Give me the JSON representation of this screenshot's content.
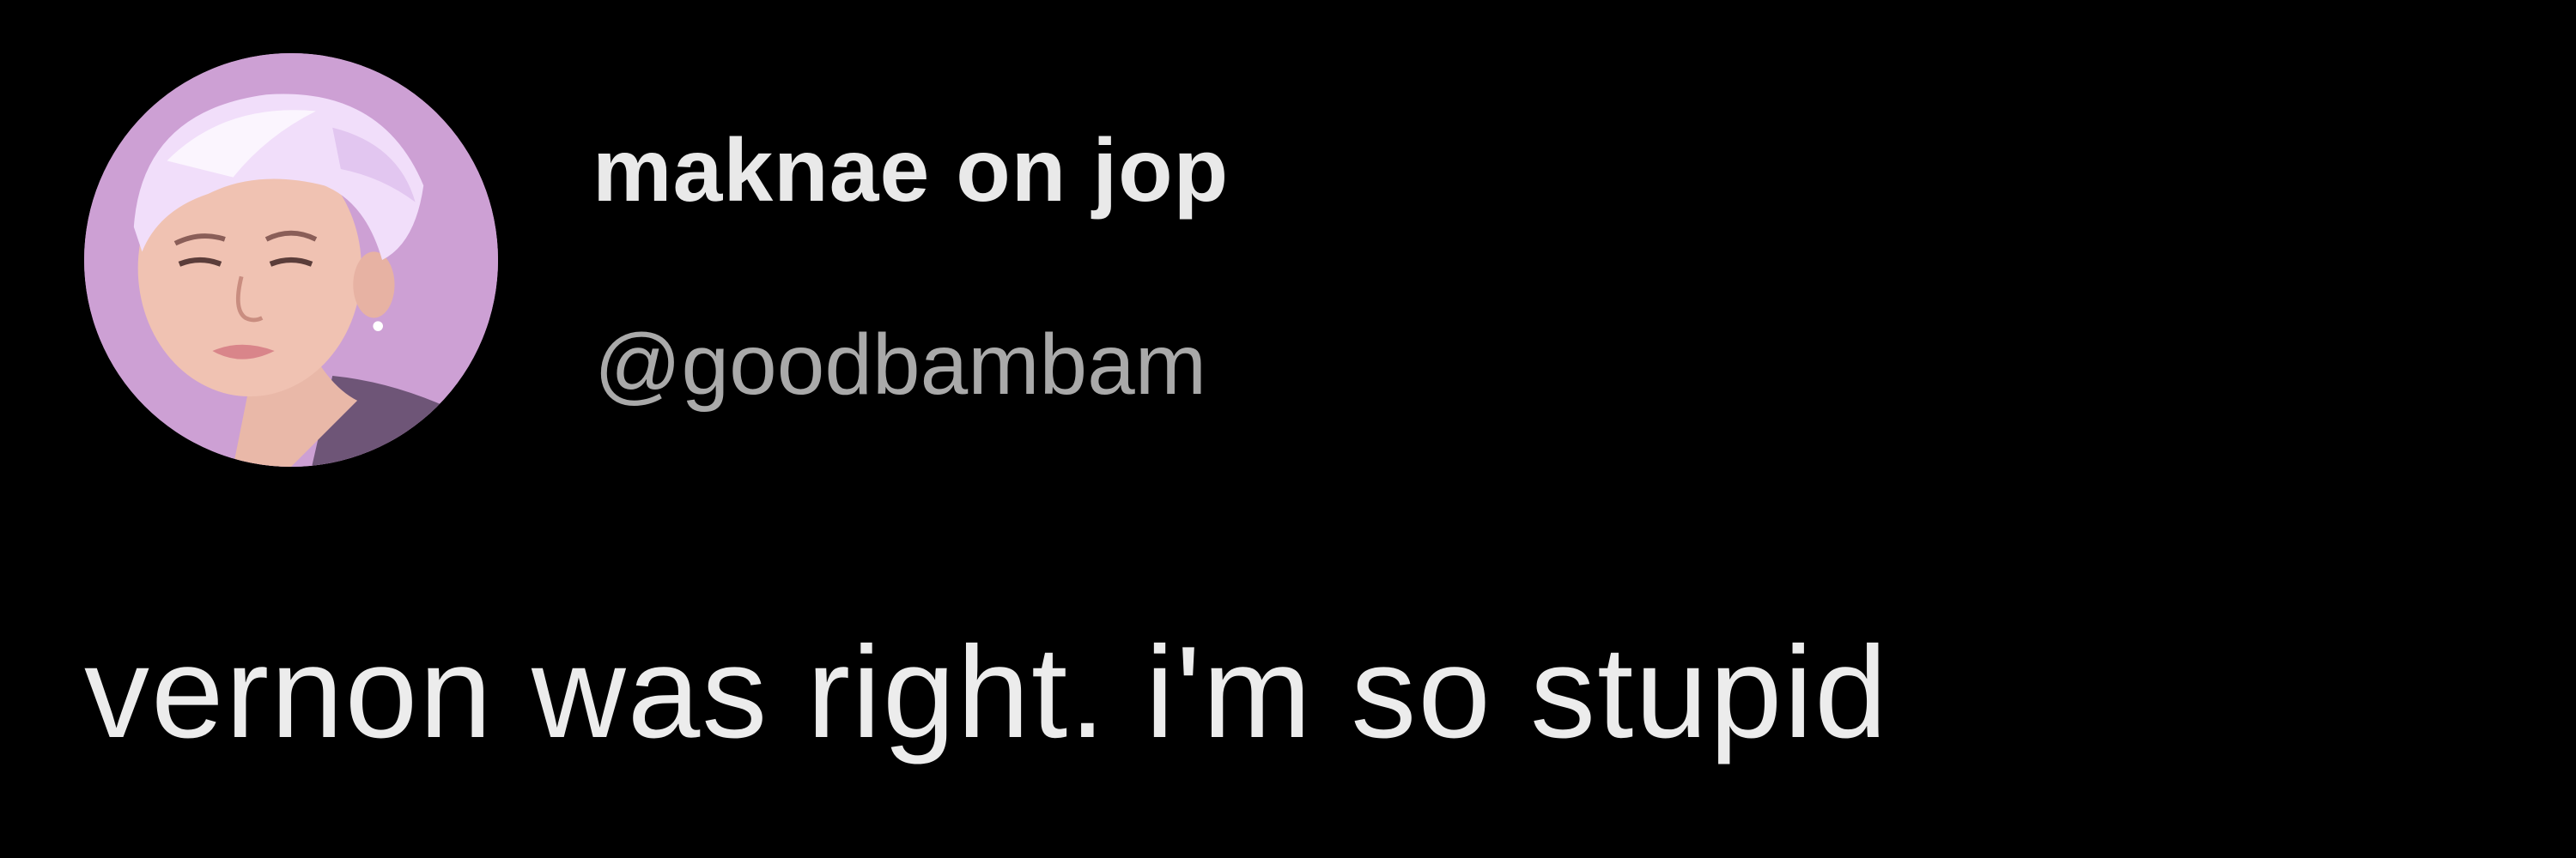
{
  "tweet": {
    "author": {
      "display_name": "maknae on jop",
      "handle": "@goodbambam",
      "avatar_icon": "profile-photo-avatar"
    },
    "text": "vernon was right. i'm so stupid"
  },
  "colors": {
    "background": "#000000",
    "name_text": "#e9e9e9",
    "handle_text": "#a9a9a9",
    "body_text": "#ececec",
    "avatar_background": "#cfa3d6"
  }
}
